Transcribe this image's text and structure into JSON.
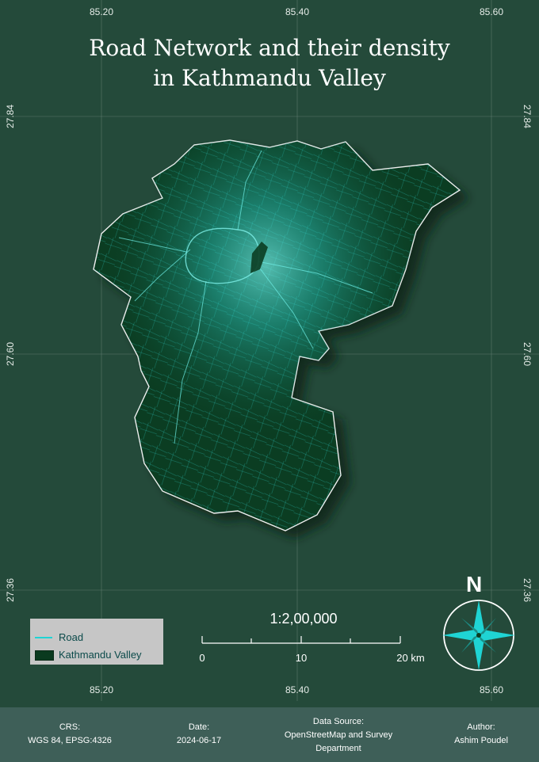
{
  "title": {
    "line1": "Road Network and their density",
    "line2": "in Kathmandu Valley"
  },
  "grid": {
    "lon_labels": [
      "85.20",
      "85.40",
      "85.60"
    ],
    "lat_labels": [
      "27.84",
      "27.60",
      "27.36"
    ]
  },
  "legend": {
    "road_label": "Road",
    "valley_label": "Kathmandu Valley"
  },
  "scale": {
    "ratio": "1:2,00,000",
    "labels": [
      "0",
      "10",
      "20 km"
    ]
  },
  "north_arrow": {
    "letter": "N",
    "icon": "compass-rose-icon"
  },
  "footer": {
    "crs_label": "CRS:",
    "crs_value": "WGS 84,  EPSG:4326",
    "date_label": "Date:",
    "date_value": "2024-06-17",
    "source_label": "Data Source:",
    "source_value_1": "OpenStreetMap and Survey",
    "source_value_2": "Department",
    "author_label": "Author:",
    "author_value": "Ashim Poudel"
  },
  "colors": {
    "map_background": "#244a3a",
    "valley_fill": "#0b3d22",
    "road": "#2ed6cf",
    "boundary": "#f0f0f0",
    "footer_background": "#3e5f58",
    "legend_background": "#c6c6c6"
  }
}
